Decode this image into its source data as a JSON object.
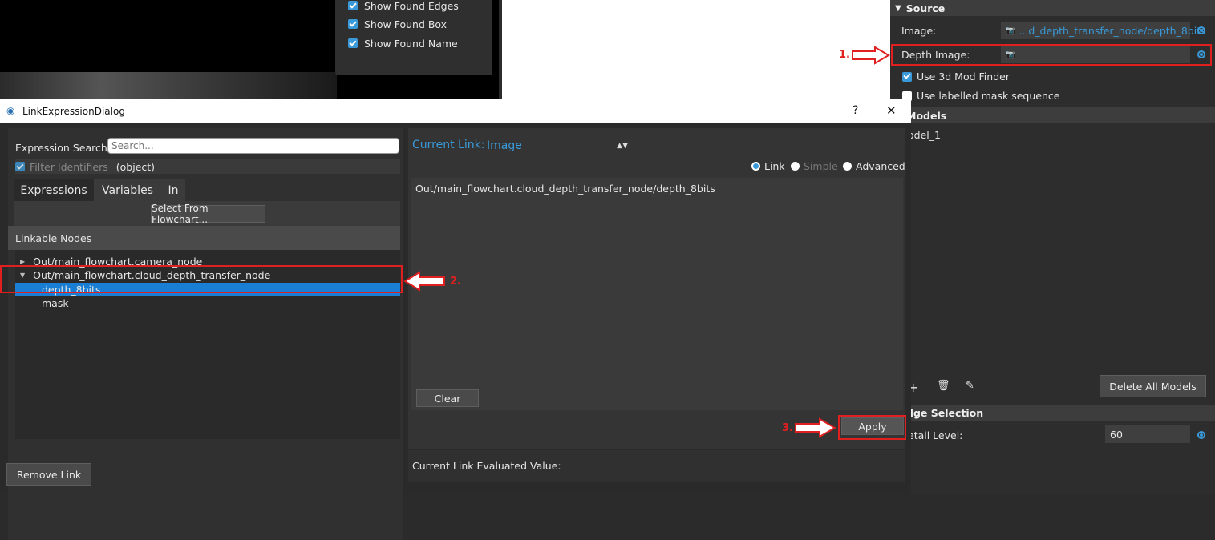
{
  "overlay_menu": {
    "items": [
      {
        "label": "Show Found Edges",
        "checked": true
      },
      {
        "label": "Show Found Box",
        "checked": true
      },
      {
        "label": "Show Found Name",
        "checked": true
      }
    ]
  },
  "properties": {
    "source_header": "Source",
    "image_label": "Image:",
    "image_value": "...d_depth_transfer_node/depth_8bits",
    "depth_image_label": "Depth Image:",
    "use_3d_label": "Use 3d Mod Finder",
    "use_3d_checked": true,
    "use_mask_label": "Use labelled mask sequence",
    "use_mask_checked": false,
    "models_header": "Models",
    "model_item": "odel_1",
    "delete_all_label": "Delete All Models",
    "edge_header": "dge Selection",
    "detail_label": "etail Level:",
    "detail_value": "60"
  },
  "dialog": {
    "title": "LinkExpressionDialog",
    "help_label": "?",
    "close_label": "✕",
    "search_label": "Expression Search:",
    "search_placeholder": "Search...",
    "filter_label": "Filter Identifiers",
    "filter_type": "(object)",
    "tabs": [
      "Expressions",
      "Variables",
      "In"
    ],
    "select_flowchart_label": "Select From Flowchart...",
    "linkable_header": "Linkable Nodes",
    "tree": {
      "node1": "Out/main_flowchart.camera_node",
      "node2": "Out/main_flowchart.cloud_depth_transfer_node",
      "child1": "depth_8bits",
      "child2": "mask"
    },
    "current_link_label": "Current Link:",
    "current_link_value": "Image",
    "modes": [
      "Link",
      "Simple",
      "Advanced"
    ],
    "expression_text": "Out/main_flowchart.cloud_depth_transfer_node/depth_8bits",
    "clear_label": "Clear",
    "evaluated_label": "Current Link Evaluated Value:",
    "apply_label": "Apply",
    "remove_link_label": "Remove Link"
  },
  "annotations": {
    "step1": "1.",
    "step2": "2.",
    "step3": "3."
  },
  "colors": {
    "accent": "#3a9ad9",
    "highlight": "#1a7fd4",
    "annotation": "#e02020"
  }
}
